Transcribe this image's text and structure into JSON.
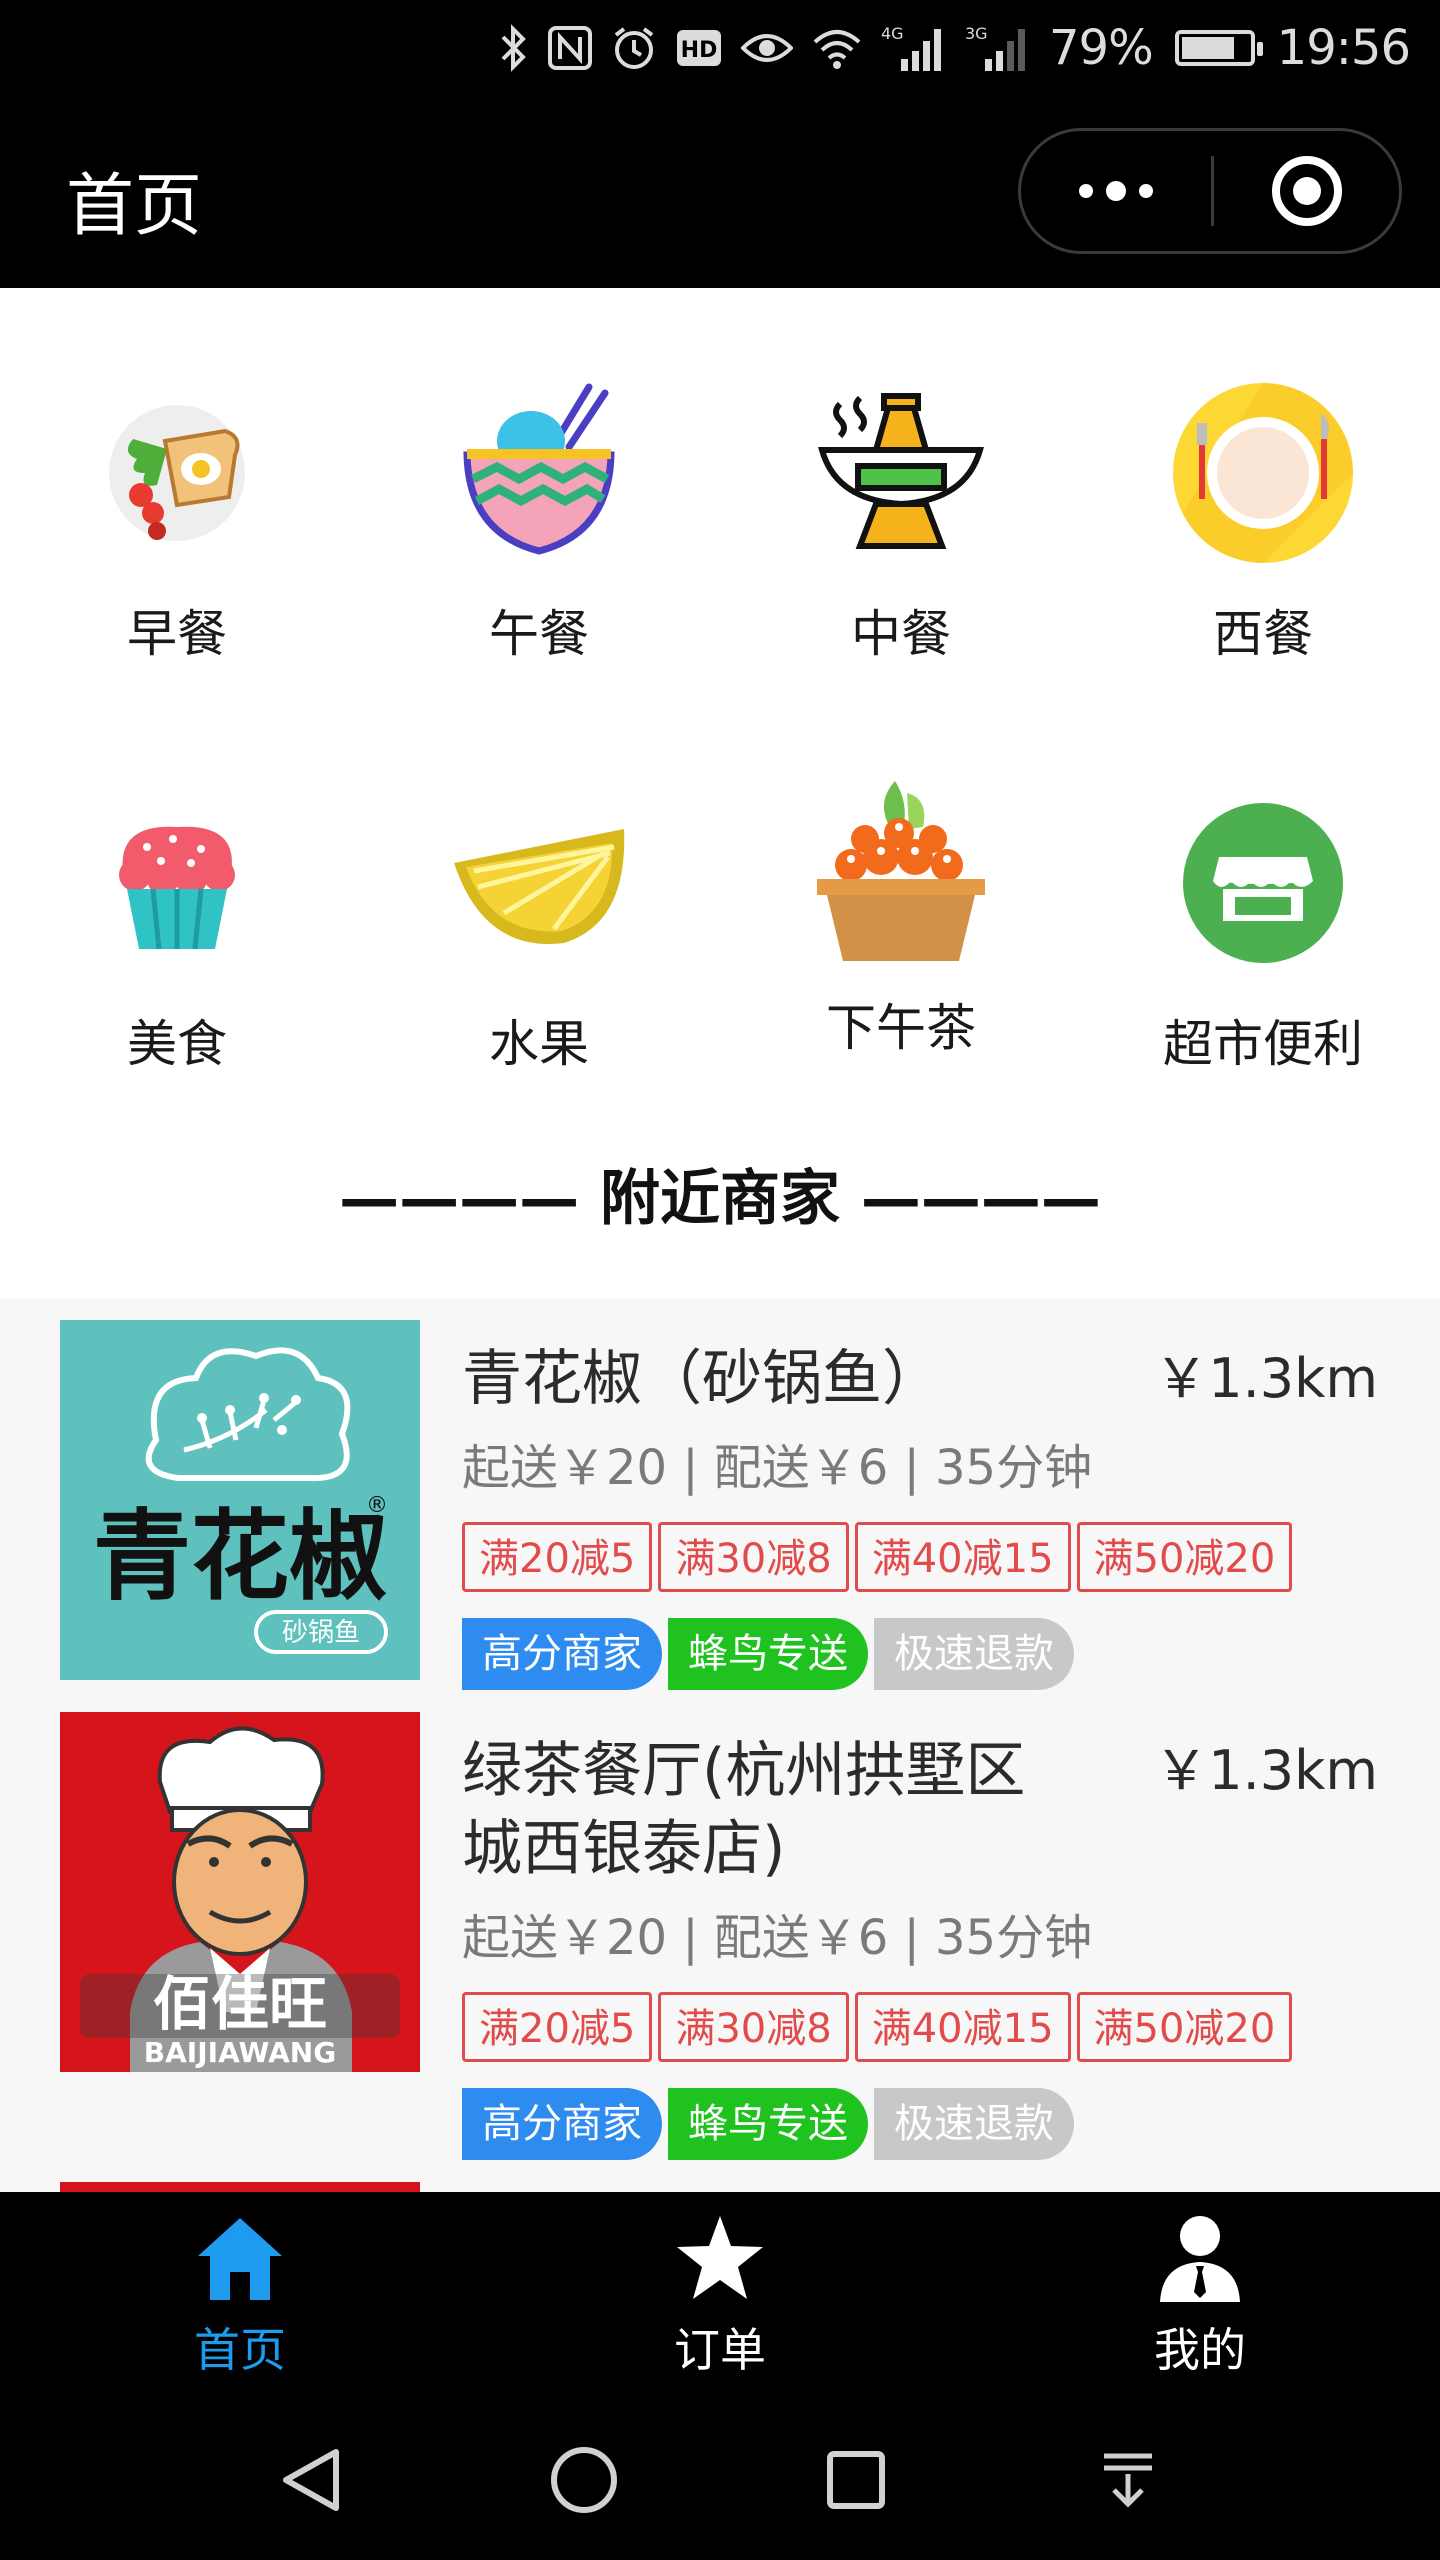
{
  "status_bar": {
    "network_4g": "4G",
    "network_3g": "3G",
    "battery": "79%",
    "battery_level": 0.79,
    "time": "19:56"
  },
  "nav": {
    "title": "首页"
  },
  "categories": [
    {
      "label": "早餐",
      "icon": "breakfast-icon"
    },
    {
      "label": "午餐",
      "icon": "lunch-bowl-icon"
    },
    {
      "label": "中餐",
      "icon": "hotpot-icon"
    },
    {
      "label": "西餐",
      "icon": "western-plate-icon"
    },
    {
      "label": "美食",
      "icon": "cupcake-icon"
    },
    {
      "label": "水果",
      "icon": "lemon-icon"
    },
    {
      "label": "下午茶",
      "icon": "tea-basket-icon"
    },
    {
      "label": "超市便利",
      "icon": "store-icon"
    }
  ],
  "section": {
    "title": "———— 附近商家 ————"
  },
  "shops": [
    {
      "name": "青花椒（砂锅鱼）",
      "distance": "￥1.3km",
      "meta": "起送￥20 | 配送￥6 | 35分钟",
      "logo_text": "青花椒",
      "logo_sub": "砂锅鱼",
      "promos": [
        "满20减5",
        "满30减8",
        "满40减15",
        "满50减20"
      ],
      "badges": [
        {
          "label": "高分商家",
          "color": "#2e8cf0"
        },
        {
          "label": "蜂鸟专送",
          "color": "#1fc21f"
        },
        {
          "label": "极速退款",
          "color": "#c8c8c8"
        }
      ]
    },
    {
      "name": "绿茶餐厅(杭州拱墅区城西银泰店)",
      "distance": "￥1.3km",
      "meta": "起送￥20 | 配送￥6 | 35分钟",
      "logo_text": "佰佳旺",
      "logo_sub": "BAIJIAWANG",
      "promos": [
        "满20减5",
        "满30减8",
        "满40减15",
        "满50减20"
      ],
      "badges": [
        {
          "label": "高分商家",
          "color": "#2e8cf0"
        },
        {
          "label": "蜂鸟专送",
          "color": "#1fc21f"
        },
        {
          "label": "极速退款",
          "color": "#c8c8c8"
        }
      ]
    }
  ],
  "tabs": [
    {
      "label": "首页",
      "icon": "home-icon",
      "active": true
    },
    {
      "label": "订单",
      "icon": "star-icon",
      "active": false
    },
    {
      "label": "我的",
      "icon": "user-icon",
      "active": false
    }
  ],
  "colors": {
    "tab_active": "#1e9bef",
    "tab_inactive": "#ffffff",
    "promo_red": "#e24b4b"
  }
}
